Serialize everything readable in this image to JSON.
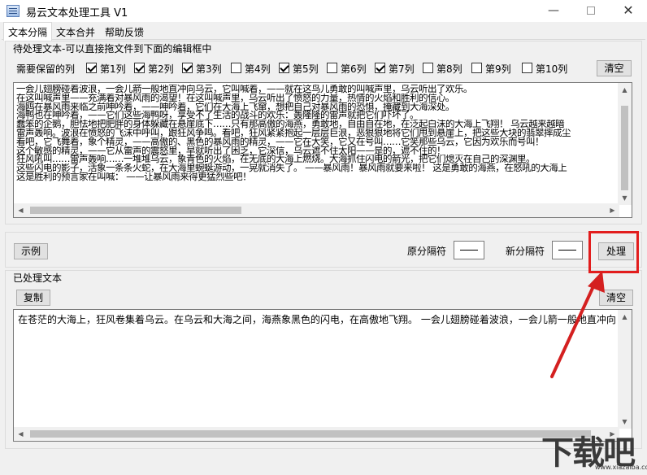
{
  "window": {
    "title": "易云文本处理工具 V1",
    "minimize": "—",
    "close": "✕"
  },
  "tabs": [
    {
      "label": "文本分隔",
      "active": true
    },
    {
      "label": "文本合并",
      "active": false
    },
    {
      "label": "帮助反馈",
      "active": false
    }
  ],
  "source": {
    "group_label": "待处理文本-可以直接拖文件到下面的编辑框中",
    "columns_label": "需要保留的列",
    "columns": [
      {
        "label": "第1列",
        "checked": true
      },
      {
        "label": "第2列",
        "checked": true
      },
      {
        "label": "第3列",
        "checked": true
      },
      {
        "label": "第4列",
        "checked": false
      },
      {
        "label": "第5列",
        "checked": true
      },
      {
        "label": "第6列",
        "checked": false
      },
      {
        "label": "第7列",
        "checked": true
      },
      {
        "label": "第8列",
        "checked": false
      },
      {
        "label": "第9列",
        "checked": false
      },
      {
        "label": "第10列",
        "checked": false
      }
    ],
    "clear_label": "清空",
    "lines": [
      " 一会儿翅膀碰着波浪，一会儿箭一般地直冲向乌云，它叫喊着，——就在这鸟儿勇敢的叫喊声里，乌云听出了欢乐。",
      "在这叫喊声里——充满着对暴风雨的渴望！在这叫喊声里，乌云听出了愤怒的力量，热情的火焰和胜利的信心。",
      "海鸥在暴风雨来临之前呻吟着，——呻吟着，它们在大海上飞窜，想把自己对暴风雨的恐惧，掩藏到大海深处。",
      "  海鸭也在呻吟着，——它们这些海鸭呀，享受不了生活的战斗的欢乐：轰隆隆的雷声就把它们吓坏了。",
      "  蠢笨的企鹅，胆怯地把肥胖的身体躲藏在悬崖底下……只有那高傲的海燕，勇敢地，自由自在地，在泛起白沫的大海上飞翔！  乌云越来越暗",
      "雷声轰响。波浪在愤怒的飞沫中呼叫，跟狂风争鸣。看吧，狂风紧紧抱起一层层巨浪，恶狠狠地将它们甩到悬崖上，把这些大块的翡翠摔成尘",
      "  看吧，它飞舞着，象个精灵，——高傲的、黑色的暴风雨的精灵，——它在大笑，它又在号叫……它笑那些乌云，它因为欢乐而号叫！",
      "  这个敏感的精灵，——它从雷声的震怒里，早就听出了困乏，它深信，乌云遮不住太阳——是的，遮不住的！",
      "  狂风吼叫……雷声轰响……一堆堆乌云，象青色的火焰，在无底的大海上燃烧。大海抓住闪电的箭光，把它们熄灭在自己的深渊里。",
      "这些闪电的影子，活象一条条火蛇，在大海里蜿蜒游动，一晃就消失了。  ——暴风雨！暴风雨就要来啦！  这是勇敢的海燕，在怒吼的大海上",
      "这是胜利的预言家在叫喊：  ——让暴风雨来得更猛烈些吧！"
    ]
  },
  "controls": {
    "sample_label": "示例",
    "old_sep_label": "原分隔符",
    "old_sep_value": "",
    "new_sep_label": "新分隔符",
    "new_sep_value": "",
    "process_label": "处理"
  },
  "result": {
    "group_label": "已处理文本",
    "copy_label": "复制",
    "clear_label": "清空",
    "lines": [
      "在苍茫的大海上，狂风卷集着乌云。在乌云和大海之间，海燕象黑色的闪电，在高傲地飞翔。   一会儿翅膀碰着波浪，一会儿箭一般地直冲向"
    ]
  },
  "watermark": {
    "text": "下载吧",
    "url": "www.xiazaiba.com"
  },
  "colors": {
    "highlight": "#e21d1d",
    "arrow": "#d42020"
  }
}
